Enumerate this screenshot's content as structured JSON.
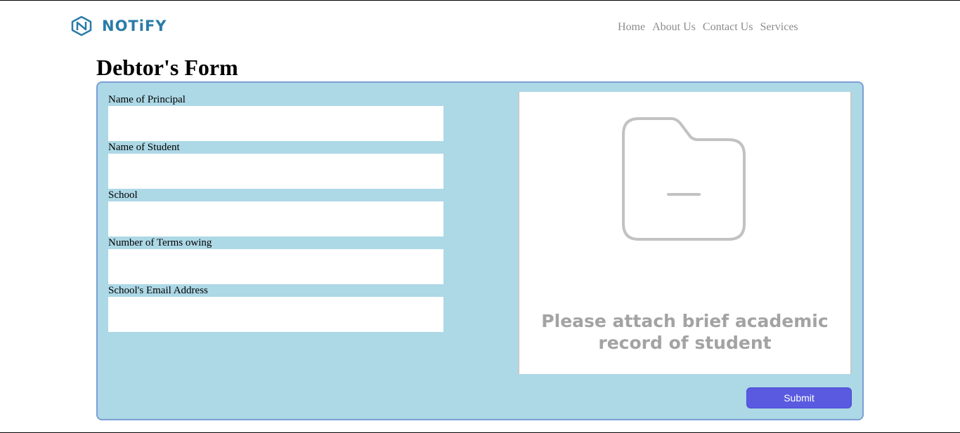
{
  "brand": {
    "name": "NOTiFY",
    "accent": "#2a7ca8"
  },
  "nav": {
    "items": [
      "Home",
      "About Us",
      "Contact Us",
      "Services"
    ]
  },
  "page": {
    "title": "Debtor's Form"
  },
  "form": {
    "fields": [
      {
        "label": "Name of Principal",
        "value": ""
      },
      {
        "label": "Name of Student",
        "value": ""
      },
      {
        "label": "School",
        "value": ""
      },
      {
        "label": "Number of Terms owing",
        "value": ""
      },
      {
        "label": "School's Email Address",
        "value": ""
      }
    ],
    "upload": {
      "icon": "folder-icon",
      "line1": "Please attach brief academic",
      "line2": "record of student"
    },
    "submit_label": "Submit"
  },
  "colors": {
    "panel_bg": "#add8e6",
    "panel_border": "#7b9fd6",
    "submit_bg": "#5a5ae0"
  }
}
